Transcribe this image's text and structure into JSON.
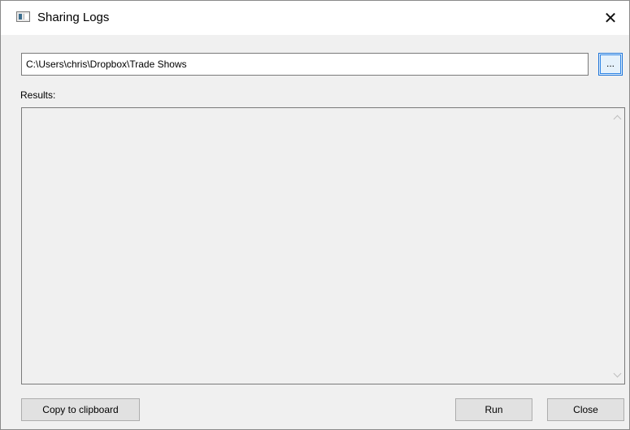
{
  "window": {
    "title": "Sharing Logs",
    "close_glyph": "✕",
    "icon": "app-window-icon"
  },
  "path_field": {
    "value": "C:\\Users\\chris\\Dropbox\\Trade Shows"
  },
  "browse_button": {
    "label": "..."
  },
  "results": {
    "label": "Results:",
    "content": ""
  },
  "buttons": {
    "copy_label": "Copy to clipboard",
    "run_label": "Run",
    "close_label": "Close"
  },
  "colors": {
    "dialog_bg": "#f0f0f0",
    "focus_blue": "#1e74d8"
  }
}
